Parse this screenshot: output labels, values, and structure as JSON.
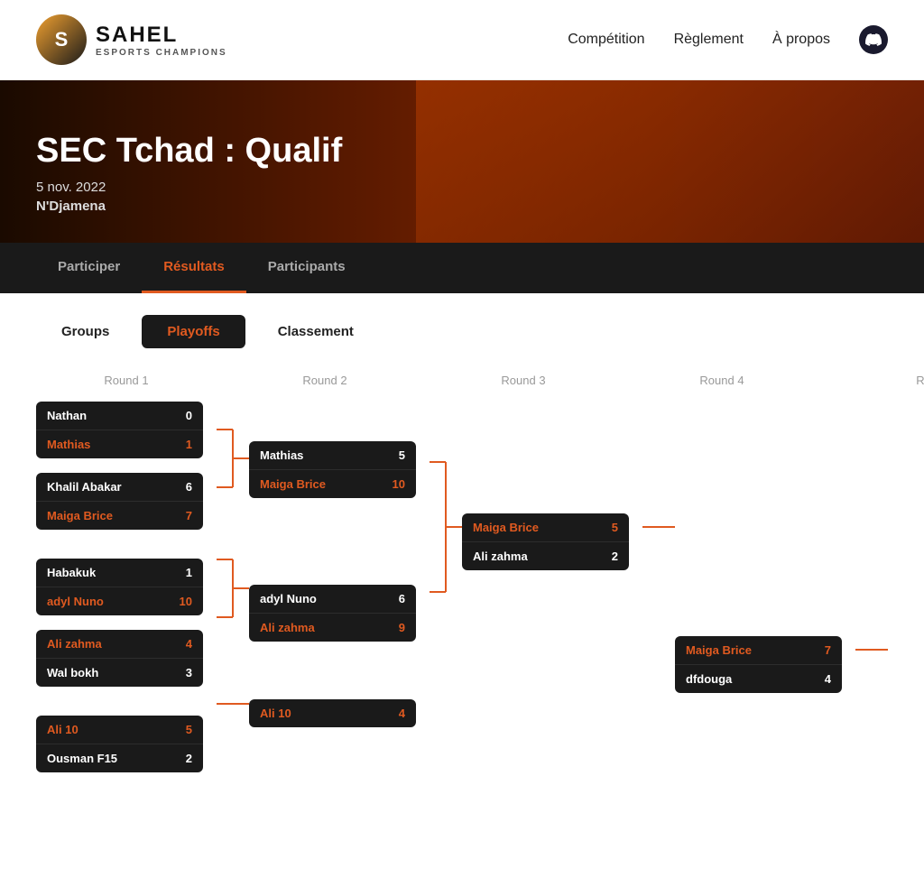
{
  "header": {
    "logo_letter": "S",
    "brand": "SAHEL",
    "sub": "ESPORTS CHAMPIONS",
    "nav": [
      {
        "label": "Compétition",
        "id": "competition"
      },
      {
        "label": "Règlement",
        "id": "reglement"
      },
      {
        "label": "À propos",
        "id": "apropos"
      }
    ]
  },
  "hero": {
    "title": "SEC Tchad : Qualif",
    "date": "5 nov. 2022",
    "location": "N'Djamena"
  },
  "tabs": [
    {
      "label": "Participer",
      "active": false
    },
    {
      "label": "Résultats",
      "active": true
    },
    {
      "label": "Participants",
      "active": false
    }
  ],
  "filter_tabs": [
    {
      "label": "Groups",
      "active": false
    },
    {
      "label": "Playoffs",
      "active": true
    },
    {
      "label": "Classement",
      "active": false
    }
  ],
  "rounds": [
    {
      "label": "Round 1"
    },
    {
      "label": "Round 2"
    },
    {
      "label": "Round 3"
    },
    {
      "label": "Round 4"
    },
    {
      "label": "R"
    }
  ],
  "bracket": {
    "round1": [
      {
        "players": [
          {
            "name": "Nathan",
            "score": "0",
            "winner": false
          },
          {
            "name": "Mathias",
            "score": "1",
            "winner": true
          }
        ]
      },
      {
        "players": [
          {
            "name": "Khalil Abakar",
            "score": "6",
            "winner": false
          },
          {
            "name": "Maiga Brice",
            "score": "7",
            "winner": true
          }
        ]
      },
      {
        "players": [
          {
            "name": "Habakuk",
            "score": "1",
            "winner": false
          },
          {
            "name": "adyl Nuno",
            "score": "10",
            "winner": true
          }
        ]
      },
      {
        "players": [
          {
            "name": "Ali zahma",
            "score": "4",
            "winner": true
          },
          {
            "name": "Wal bokh",
            "score": "3",
            "winner": false
          }
        ]
      },
      {
        "players": [
          {
            "name": "Ali 10",
            "score": "5",
            "winner": true
          },
          {
            "name": "Ousman F15",
            "score": "2",
            "winner": false
          }
        ]
      }
    ],
    "round2": [
      {
        "players": [
          {
            "name": "Mathias",
            "score": "5",
            "winner": false
          },
          {
            "name": "Maiga Brice",
            "score": "10",
            "winner": true
          }
        ]
      },
      {
        "players": [
          {
            "name": "adyl Nuno",
            "score": "6",
            "winner": false
          },
          {
            "name": "Ali zahma",
            "score": "9",
            "winner": true
          }
        ]
      },
      {
        "players": [
          {
            "name": "Ali 10",
            "score": "4",
            "winner": true
          },
          {
            "name": "",
            "score": "",
            "winner": false
          }
        ]
      }
    ],
    "round3": [
      {
        "players": [
          {
            "name": "Maiga Brice",
            "score": "5",
            "winner": true
          },
          {
            "name": "Ali zahma",
            "score": "2",
            "winner": false
          }
        ]
      }
    ],
    "round4": [
      {
        "players": [
          {
            "name": "Maiga Brice",
            "score": "7",
            "winner": true
          },
          {
            "name": "dfdouga",
            "score": "4",
            "winner": false
          }
        ]
      }
    ]
  }
}
